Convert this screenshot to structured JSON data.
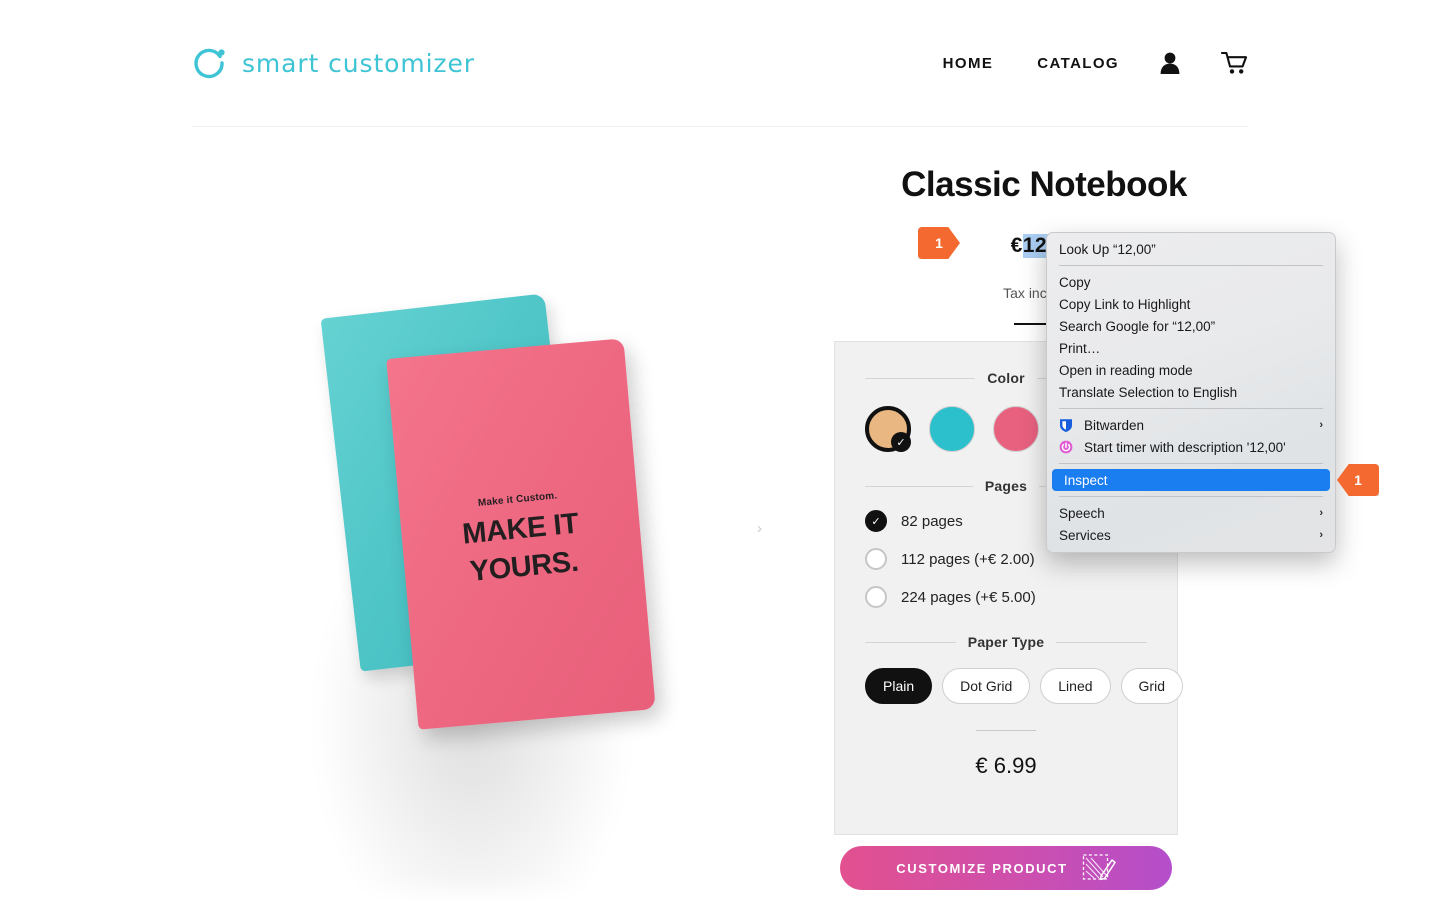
{
  "header": {
    "brand_name": "smart customizer",
    "brand_color": "#3ec4d4",
    "nav": [
      {
        "label": "HOME",
        "name": "nav-home"
      },
      {
        "label": "CATALOG",
        "name": "nav-catalog"
      }
    ],
    "account_icon": "person-icon",
    "cart_icon": "cart-icon"
  },
  "gallery": {
    "notebook_front_small_text": "Make it Custom.",
    "notebook_front_line1": "MAKE IT",
    "notebook_front_line2": "YOURS.",
    "front_color": "#ef6a83",
    "back_color": "#50c6c8",
    "next_arrow": "›"
  },
  "product": {
    "title": "Classic Notebook",
    "currency_symbol": "€",
    "price_value": "12,00",
    "price_full": "€ 12,00",
    "tax_note": "Tax included."
  },
  "configurator": {
    "color": {
      "title": "Color",
      "swatches": [
        {
          "name": "swatch-tan",
          "hex": "#e9b782",
          "selected": true
        },
        {
          "name": "swatch-teal",
          "hex": "#2bc0cc",
          "selected": false
        },
        {
          "name": "swatch-pink",
          "hex": "#e8617f",
          "selected": false
        },
        {
          "name": "swatch-hidden",
          "hex": "#d9d9d9",
          "selected": false
        }
      ],
      "check_glyph": "✓"
    },
    "pages": {
      "title": "Pages",
      "options": [
        {
          "label": "82 pages",
          "selected": true
        },
        {
          "label": "112 pages (+€ 2.00)",
          "selected": false
        },
        {
          "label": "224 pages (+€ 5.00)",
          "selected": false
        }
      ],
      "check_glyph": "✓"
    },
    "paper": {
      "title": "Paper Type",
      "options": [
        {
          "label": "Plain",
          "selected": true
        },
        {
          "label": "Dot Grid",
          "selected": false
        },
        {
          "label": "Lined",
          "selected": false
        },
        {
          "label": "Grid",
          "selected": false
        }
      ]
    },
    "total_price": "€ 6.99"
  },
  "cta": {
    "label": "CUSTOMIZE PRODUCT",
    "icon": "design-pencil-icon",
    "gradient_start": "#e2508f",
    "gradient_end": "#b44ecb"
  },
  "context_menu": {
    "items": [
      {
        "label": "Look Up “12,00”",
        "name": "ctx-look-up",
        "icon": null,
        "submenu": false,
        "highlighted": false
      },
      {
        "separator": true
      },
      {
        "label": "Copy",
        "name": "ctx-copy",
        "icon": null,
        "submenu": false,
        "highlighted": false
      },
      {
        "label": "Copy Link to Highlight",
        "name": "ctx-copy-link-to-highlight",
        "icon": null,
        "submenu": false,
        "highlighted": false
      },
      {
        "label": "Search Google for “12,00”",
        "name": "ctx-search-google",
        "icon": null,
        "submenu": false,
        "highlighted": false
      },
      {
        "label": "Print…",
        "name": "ctx-print",
        "icon": null,
        "submenu": false,
        "highlighted": false
      },
      {
        "label": "Open in reading mode",
        "name": "ctx-open-reading-mode",
        "icon": null,
        "submenu": false,
        "highlighted": false
      },
      {
        "label": "Translate Selection to English",
        "name": "ctx-translate-selection",
        "icon": null,
        "submenu": false,
        "highlighted": false
      },
      {
        "separator": true
      },
      {
        "label": "Bitwarden",
        "name": "ctx-bitwarden",
        "icon": "bitwarden-shield-icon",
        "submenu": true,
        "highlighted": false
      },
      {
        "label": "Start timer with description '12,00'",
        "name": "ctx-start-timer",
        "icon": "timer-power-icon",
        "submenu": false,
        "highlighted": false
      },
      {
        "separator": true
      },
      {
        "label": "Inspect",
        "name": "ctx-inspect",
        "icon": null,
        "submenu": false,
        "highlighted": true
      },
      {
        "separator": true
      },
      {
        "label": "Speech",
        "name": "ctx-speech",
        "icon": null,
        "submenu": true,
        "highlighted": false
      },
      {
        "label": "Services",
        "name": "ctx-services",
        "icon": null,
        "submenu": true,
        "highlighted": false
      }
    ],
    "highlight_color": "#1a7df0",
    "submenu_arrow": "›"
  },
  "annotations": {
    "badge_price": "1",
    "badge_inspect": "1",
    "badge_color": "#f4692f"
  }
}
